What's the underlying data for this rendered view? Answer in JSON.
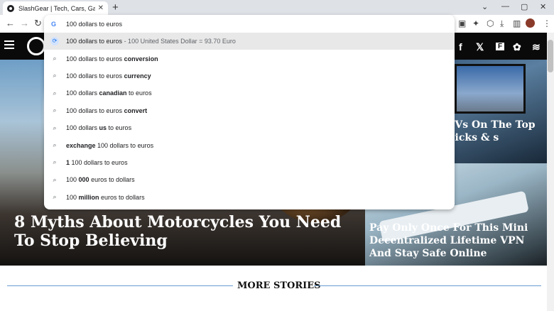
{
  "tab": {
    "title": "SlashGear | Tech, Cars, Gaming, S",
    "close": "✕",
    "new_tab": "+"
  },
  "window": {
    "minimize": "—",
    "maximize": "▢",
    "close": "✕",
    "chevron": "⌄"
  },
  "nav": {
    "back": "←",
    "forward": "→",
    "reload": "↻"
  },
  "omnibox": {
    "value": "100 dollars to euros",
    "suggestions": [
      {
        "pre": "100 dollars to euros",
        "bold": "",
        "post": "",
        "extra": " - 100 United States Dollar = 93.70 Euro",
        "type": "convert"
      },
      {
        "pre": "100 dollars to euros ",
        "bold": "conversion",
        "post": "",
        "extra": "",
        "type": "search"
      },
      {
        "pre": "100 dollars to euros ",
        "bold": "currency",
        "post": "",
        "extra": "",
        "type": "search"
      },
      {
        "pre": "100 dollars ",
        "bold": "canadian",
        "post": " to euros",
        "extra": "",
        "type": "search"
      },
      {
        "pre": "100 dollars to euros ",
        "bold": "convert",
        "post": "",
        "extra": "",
        "type": "search"
      },
      {
        "pre": "100 dollars ",
        "bold": "us",
        "post": " to euros",
        "extra": "",
        "type": "search"
      },
      {
        "pre": "",
        "bold": "exchange",
        "post": " 100 dollars to euros",
        "extra": "",
        "type": "search"
      },
      {
        "pre": "",
        "bold": "1",
        "post": " 100 dollars to euros",
        "extra": "",
        "type": "search"
      },
      {
        "pre": "100 ",
        "bold": "000",
        "post": " euros to dollars",
        "extra": "",
        "type": "search"
      },
      {
        "pre": "100 ",
        "bold": "million",
        "post": " euros to dollars",
        "extra": "",
        "type": "search"
      }
    ]
  },
  "site": {
    "social": [
      "f",
      "𝕏",
      "F",
      "✿",
      "≋"
    ],
    "hero_title": "8 Myths About Motorcycles You Need To Stop Believing",
    "card_tv_title": "TVs On The Top Picks & s",
    "card_vpn_title": "Pay Only Once For This Mini Decentralized Lifetime VPN And Stay Safe Online",
    "more_stories": "MORE STORIES"
  },
  "colors": {
    "accent": "#4285f4",
    "rule": "#6a9bd0"
  }
}
